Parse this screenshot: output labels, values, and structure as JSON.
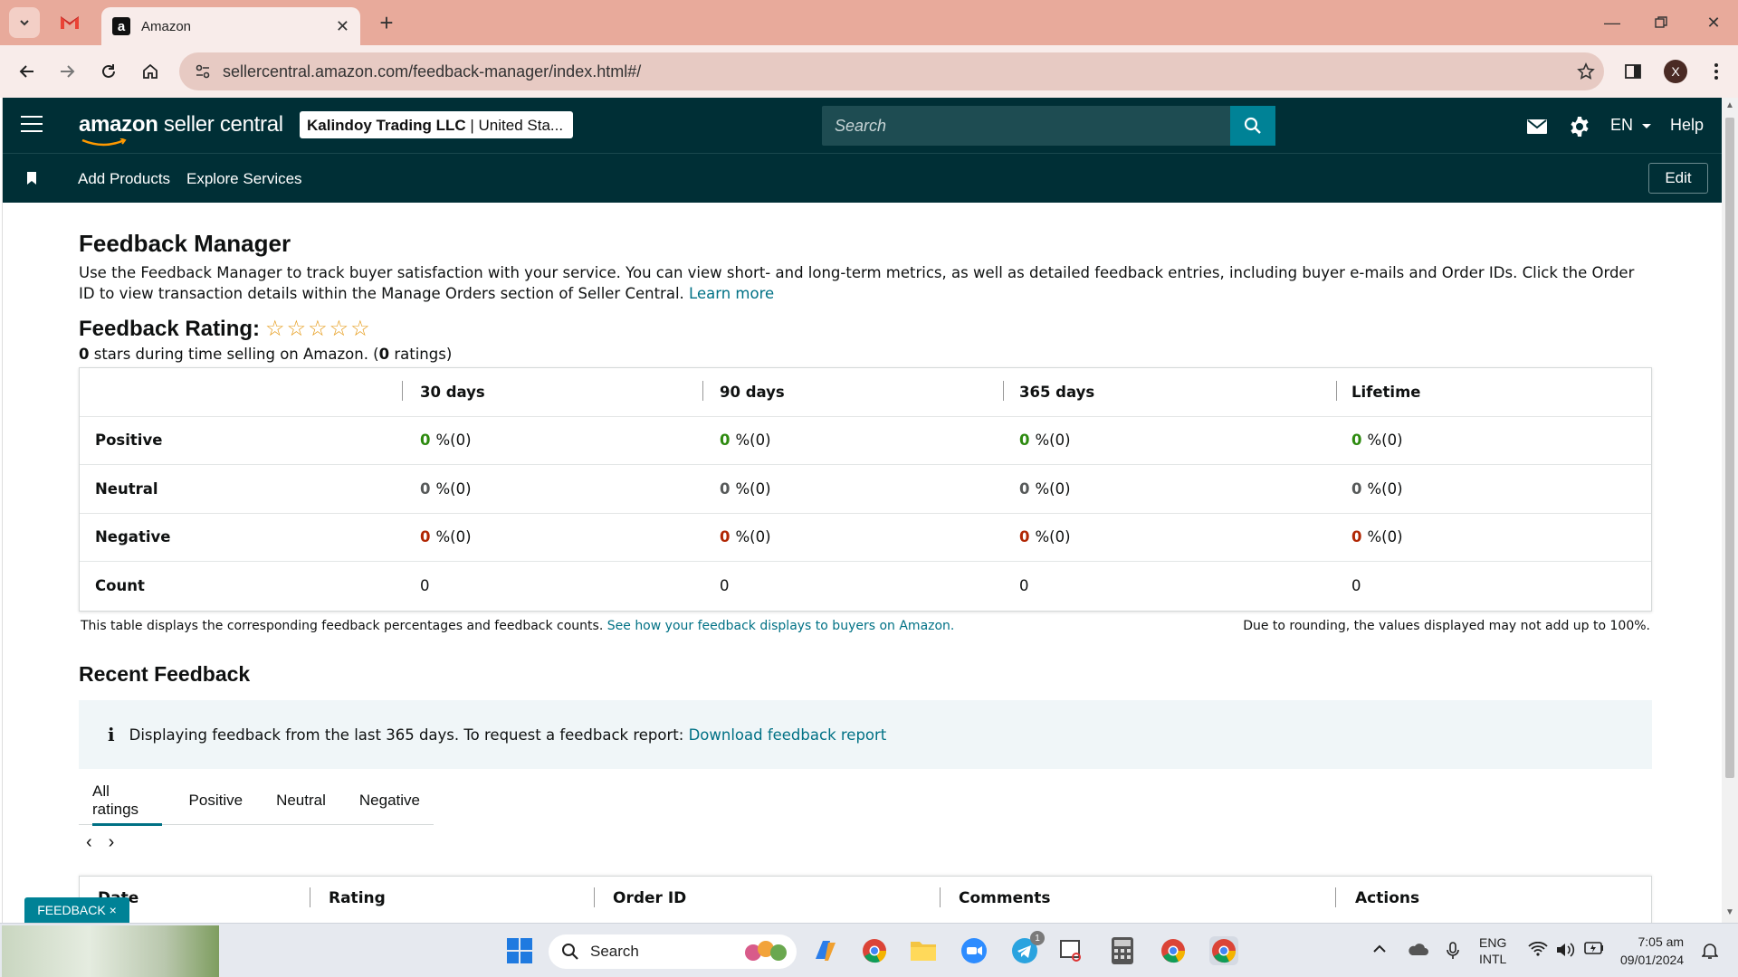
{
  "browser": {
    "tab_title": "Amazon",
    "url": "sellercentral.amazon.com/feedback-manager/index.html#/",
    "profile_initial": "X"
  },
  "header": {
    "logo_bold": "amazon",
    "logo_rest": " seller central",
    "account_name": "Kalindoy Trading LLC",
    "account_region": " | United Sta...",
    "search_placeholder": "Search",
    "language": "EN",
    "help": "Help"
  },
  "subnav": {
    "links": [
      "Add Products",
      "Explore Services"
    ],
    "edit": "Edit"
  },
  "page": {
    "title": "Feedback Manager",
    "intro": "Use the Feedback Manager to track buyer satisfaction with your service. You can view short- and long-term metrics, as well as detailed feedback entries, including buyer e-mails and Order IDs. Click the Order ID to view transaction details within the Manage Orders section of Seller Central.",
    "learn_more": "Learn more",
    "rating_label": "Feedback Rating:",
    "stars_filled": 0,
    "stars_total": 5,
    "rating_value": "0",
    "rating_sub_mid": " stars during time selling on Amazon. (",
    "rating_count": "0",
    "rating_sub_end": " ratings)"
  },
  "metrics": {
    "columns": [
      "30 days",
      "90 days",
      "365 days",
      "Lifetime"
    ],
    "rows": [
      {
        "label": "Positive",
        "color": "green",
        "cells": [
          {
            "v": "0",
            "s": "%(0)"
          },
          {
            "v": "0",
            "s": "%(0)"
          },
          {
            "v": "0",
            "s": "%(0)"
          },
          {
            "v": "0",
            "s": "%(0)"
          }
        ]
      },
      {
        "label": "Neutral",
        "color": "gray",
        "cells": [
          {
            "v": "0",
            "s": "%(0)"
          },
          {
            "v": "0",
            "s": "%(0)"
          },
          {
            "v": "0",
            "s": "%(0)"
          },
          {
            "v": "0",
            "s": "%(0)"
          }
        ]
      },
      {
        "label": "Negative",
        "color": "red",
        "cells": [
          {
            "v": "0",
            "s": "%(0)"
          },
          {
            "v": "0",
            "s": "%(0)"
          },
          {
            "v": "0",
            "s": "%(0)"
          },
          {
            "v": "0",
            "s": "%(0)"
          }
        ]
      },
      {
        "label": "Count",
        "color": "plain",
        "cells": [
          {
            "v": "0",
            "s": ""
          },
          {
            "v": "0",
            "s": ""
          },
          {
            "v": "0",
            "s": ""
          },
          {
            "v": "0",
            "s": ""
          }
        ]
      }
    ],
    "note": "This table displays the corresponding feedback percentages and feedback counts.",
    "note_link": "See how your feedback displays to buyers on Amazon.",
    "rounding_note": "Due to rounding, the values displayed may not add up to 100%."
  },
  "recent": {
    "title": "Recent Feedback",
    "banner_text": "Displaying feedback from the last 365 days. To request a feedback report:",
    "banner_link": "Download feedback report",
    "tabs": [
      "All ratings",
      "Positive",
      "Neutral",
      "Negative"
    ],
    "active_tab": 0,
    "table_headers": [
      "Date",
      "Rating",
      "Order ID",
      "Comments",
      "Actions"
    ]
  },
  "feedback_widget": "FEEDBACK ×",
  "taskbar": {
    "search": "Search",
    "lang_top": "ENG",
    "lang_bottom": "INTL",
    "time": "7:05 am",
    "date": "09/01/2024",
    "telegram_badge": "1"
  },
  "colors": {
    "header_bg": "#002f36",
    "search_btn": "#008296",
    "link": "#007185",
    "positive": "#2d8a0f",
    "negative": "#b12704",
    "star": "#e69c1b"
  }
}
